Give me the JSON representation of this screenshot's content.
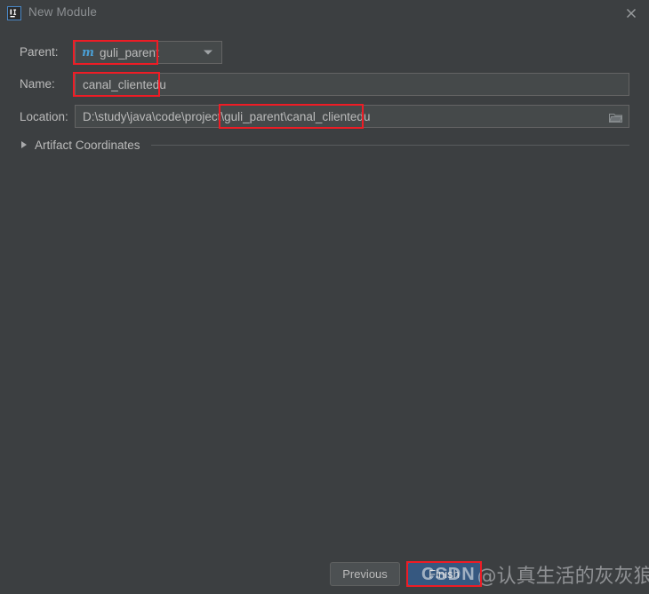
{
  "window": {
    "title": "New Module",
    "app_icon": "intellij-idea-icon",
    "close_icon": "close-icon",
    "background_color": "#3c3f41"
  },
  "form": {
    "parent": {
      "label": "Parent:",
      "value": "guli_parent",
      "icon": "maven-module-icon",
      "icon_glyph": "m",
      "icon_color": "#4a9fd4",
      "dropdown_icon": "chevron-down-icon"
    },
    "name": {
      "label": "Name:",
      "value": "canal_clientedu",
      "placeholder": ""
    },
    "location": {
      "label": "Location:",
      "value": "D:\\study\\java\\code\\project\\guli_parent\\canal_clientedu",
      "browse_icon": "folder-icon"
    },
    "artifact_coordinates": {
      "label": "Artifact Coordinates",
      "expand_icon": "chevron-right-icon",
      "expanded": false
    }
  },
  "footer": {
    "previous_label": "Previous",
    "finish_label": "Finish",
    "finish_accent_color": "#365880"
  },
  "annotations": {
    "color": "#ee1c25",
    "boxes": [
      "parent-value-highlight",
      "name-value-highlight",
      "location-suffix-highlight",
      "finish-button-highlight"
    ]
  },
  "watermark": {
    "brand": "CSDN",
    "user": "@认真生活的灰灰狼"
  }
}
